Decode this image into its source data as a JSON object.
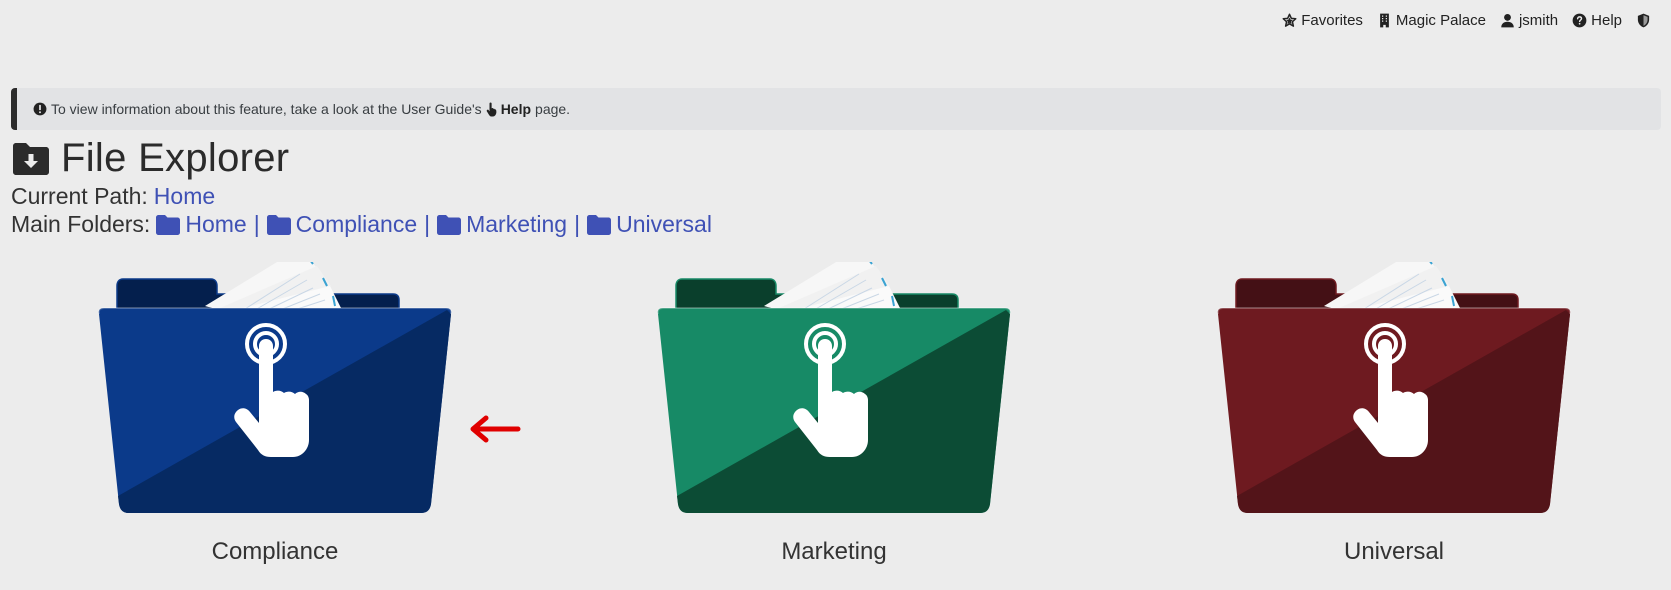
{
  "topnav": {
    "favorites": "Favorites",
    "property": "Magic Palace",
    "user": "jsmith",
    "help": "Help"
  },
  "banner": {
    "text_before": "To view information about this feature, take a look at the User Guide's",
    "help_link": "Help",
    "text_after": "page."
  },
  "header": {
    "title": "File Explorer",
    "current_path_label": "Current Path:",
    "current_path_value": "Home",
    "main_folders_label": "Main Folders:",
    "main_folders": [
      {
        "label": "Home"
      },
      {
        "label": "Compliance"
      },
      {
        "label": "Marketing"
      },
      {
        "label": "Universal"
      }
    ],
    "separator": "|"
  },
  "folders": [
    {
      "label": "Compliance",
      "color": "#0b3a8a",
      "dark": "#062a63",
      "tab": "#041f4d"
    },
    {
      "label": "Marketing",
      "color": "#178a66",
      "dark": "#0c4c35",
      "tab": "#0a3f2c"
    },
    {
      "label": "Universal",
      "color": "#6e1a20",
      "dark": "#531419",
      "tab": "#441015"
    }
  ],
  "colors": {
    "link": "#3f51b5",
    "arrow": "#e00000"
  }
}
